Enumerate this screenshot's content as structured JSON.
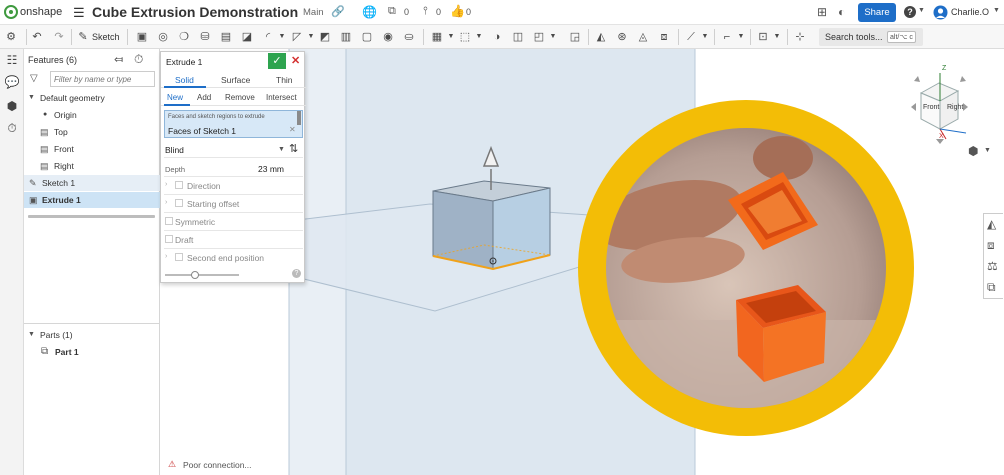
{
  "app": {
    "logo_text": "onshape",
    "doc_title": "Cube Extrusion Demonstration",
    "workspace": "Main",
    "versions_count": "0",
    "branches_count": "0",
    "likes_count": "0",
    "share_label": "Share",
    "help_label": "?",
    "user_name": "Charlie.O"
  },
  "toolbar": {
    "sketch_label": "Sketch",
    "search_label": "Search tools...",
    "search_shortcut": "alt/⌥ c"
  },
  "features": {
    "title": "Features (6)",
    "filter_placeholder": "Filter by name or type",
    "default_geometry": "Default geometry",
    "items": [
      "Origin",
      "Top",
      "Front",
      "Right"
    ],
    "sketch": "Sketch 1",
    "extrude": "Extrude 1",
    "parts_header": "Parts (1)",
    "part": "Part 1"
  },
  "dialog": {
    "title": "Extrude 1",
    "tabs": [
      "Solid",
      "Surface",
      "Thin"
    ],
    "ops": [
      "New",
      "Add",
      "Remove",
      "Intersect"
    ],
    "field_hint": "Faces and sketch regions to extrude",
    "field_value": "Faces of Sketch 1",
    "end_type": "Blind",
    "depth_label": "Depth",
    "depth_value": "23 mm",
    "direction": "Direction",
    "starting_offset": "Starting offset",
    "symmetric": "Symmetric",
    "draft": "Draft",
    "second_end": "Second end position",
    "slider_fraction": 0.4
  },
  "status": {
    "connection": "Poor connection..."
  },
  "viewcube": {
    "front": "Front",
    "right": "Right",
    "axis_z": "Z",
    "axis_x": "X"
  },
  "colors": {
    "brand_blue": "#1e6ec8",
    "accept_green": "#2ea44f",
    "cancel_red": "#d32f2f",
    "ring_yellow": "#f3bd06",
    "part_blue": "#a9c7df",
    "selection_orange": "#f0a21a"
  }
}
